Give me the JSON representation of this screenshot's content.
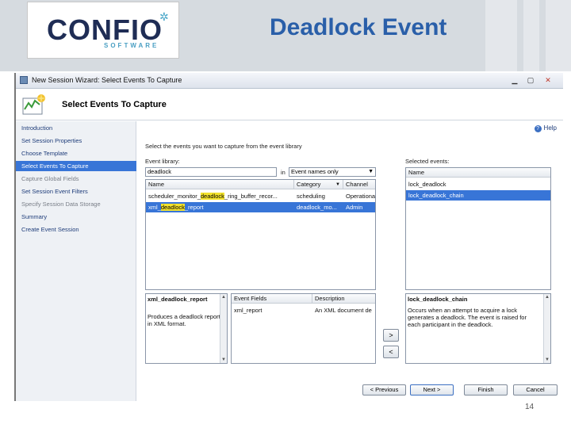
{
  "slide": {
    "title": "Deadlock Event",
    "page_number": "14",
    "logo": {
      "word": "CONFIO",
      "sub": "SOFTWARE"
    }
  },
  "window": {
    "title": "New Session Wizard: Select Events To Capture",
    "banner_title": "Select Events To Capture",
    "help_label": "Help"
  },
  "sidebar": {
    "items": [
      {
        "label": "Introduction",
        "state": "normal"
      },
      {
        "label": "Set Session Properties",
        "state": "normal"
      },
      {
        "label": "Choose Template",
        "state": "normal"
      },
      {
        "label": "Select Events To Capture",
        "state": "active"
      },
      {
        "label": "Capture Global Fields",
        "state": "dim"
      },
      {
        "label": "Set Session Event Filters",
        "state": "normal"
      },
      {
        "label": "Specify Session Data Storage",
        "state": "dim"
      },
      {
        "label": "Summary",
        "state": "normal"
      },
      {
        "label": "Create Event Session",
        "state": "normal"
      }
    ]
  },
  "main": {
    "instruction": "Select the events you want to capture from the event library",
    "event_library_label": "Event library:",
    "search_value": "deadlock",
    "in_label": "in",
    "filter_selected": "Event names only",
    "library_columns": [
      "Name",
      "Category",
      "Channel"
    ],
    "library_rows": [
      {
        "name_pre": "scheduler_monitor_",
        "name_hl": "deadlock",
        "name_post": "_ring_buffer_recor...",
        "category": "scheduling",
        "channel": "Operational",
        "selected": false
      },
      {
        "name_pre": "xml_",
        "name_hl": "deadlock",
        "name_post": "_report",
        "category": "deadlock_mo...",
        "channel": "Admin",
        "selected": true
      }
    ],
    "selected_events_label": "Selected events:",
    "selected_column": "Name",
    "selected_rows": [
      {
        "name": "lock_deadlock",
        "selected": false
      },
      {
        "name": "lock_deadlock_chain",
        "selected": true
      }
    ],
    "add_button": ">",
    "remove_button": "<",
    "detail_left": {
      "event_name": "xml_deadlock_report",
      "description": "Produces a deadlock report in XML format."
    },
    "fields_columns": [
      "Event Fields",
      "Description"
    ],
    "fields_rows": [
      {
        "field": "xml_report",
        "description": "An XML document de"
      }
    ],
    "detail_right": {
      "event_name": "lock_deadlock_chain",
      "description": "Occurs when an attempt to acquire a lock generates a deadlock. The event is raised for each participant in the deadlock."
    }
  },
  "footer": {
    "previous": "< Previous",
    "next": "Next >",
    "finish": "Finish",
    "cancel": "Cancel"
  },
  "colors": {
    "title_blue": "#2a5fa9",
    "selection": "#3875d7",
    "highlight": "#f3e22c"
  }
}
